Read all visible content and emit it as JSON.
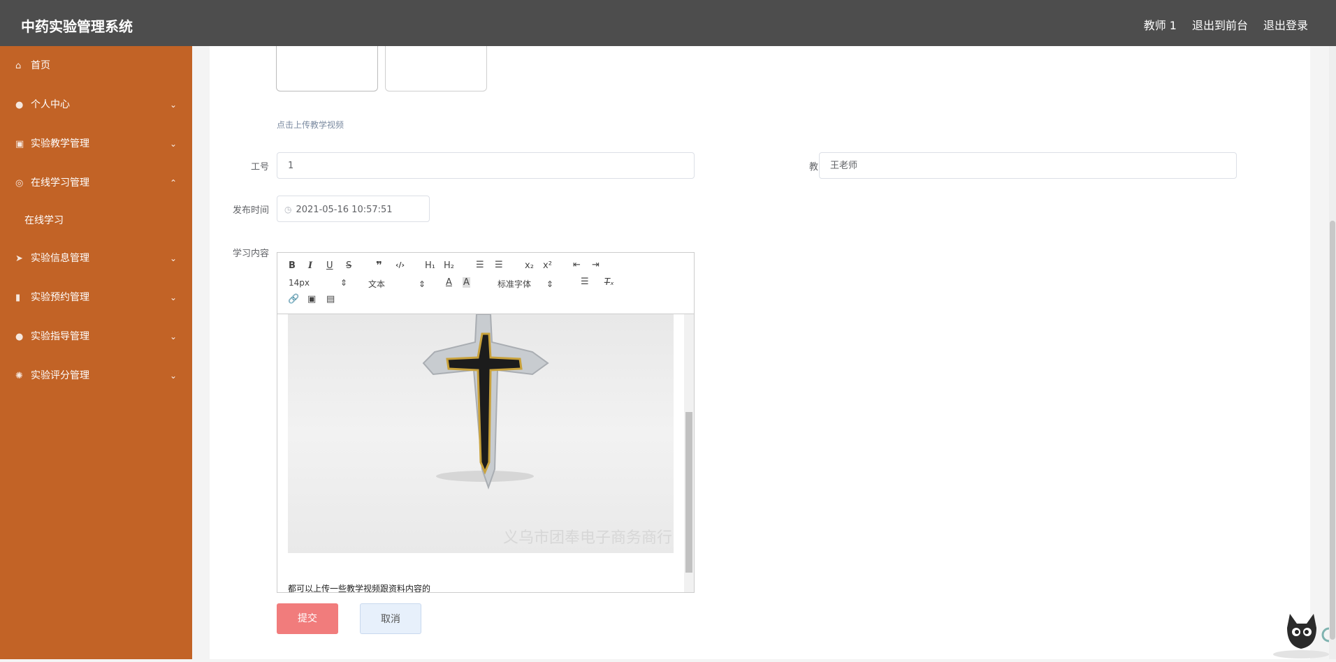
{
  "app": {
    "title": "中药实验管理系统"
  },
  "header": {
    "user": "教师 1",
    "to_front": "退出到前台",
    "logout": "退出登录"
  },
  "sidebar": {
    "items": [
      {
        "label": "首页",
        "icon": "home-icon",
        "expandable": false
      },
      {
        "label": "个人中心",
        "icon": "user-icon",
        "expandable": true
      },
      {
        "label": "实验教学管理",
        "icon": "clipboard-icon",
        "expandable": true
      },
      {
        "label": "在线学习管理",
        "icon": "globe-icon",
        "expandable": true,
        "expanded": true,
        "children": [
          {
            "label": "在线学习"
          }
        ]
      },
      {
        "label": "实验信息管理",
        "icon": "send-icon",
        "expandable": true
      },
      {
        "label": "实验预约管理",
        "icon": "bar-chart-icon",
        "expandable": true
      },
      {
        "label": "实验指导管理",
        "icon": "person-icon",
        "expandable": true
      },
      {
        "label": "实验评分管理",
        "icon": "aperture-icon",
        "expandable": true
      }
    ]
  },
  "form": {
    "upload_hint": "点击上传教学视频",
    "employee_no": {
      "label": "工号",
      "value": "1"
    },
    "teacher_name": {
      "label": "教师姓名",
      "value": "王老师"
    },
    "publish_time": {
      "label": "发布时间",
      "value": "2021-05-16 10:57:51"
    },
    "content": {
      "label": "学习内容",
      "font_size": "14px",
      "header_select": "文本",
      "font_family": "标准字体",
      "image_watermark": "义乌市团奉电子商务商行",
      "text": "都可以上传一些教学视频跟资料内容的"
    },
    "submit_label": "提交",
    "cancel_label": "取消"
  },
  "colors": {
    "sidebar": "#c26326",
    "topbar": "#4d4d4d",
    "submit": "#f17c7c"
  }
}
